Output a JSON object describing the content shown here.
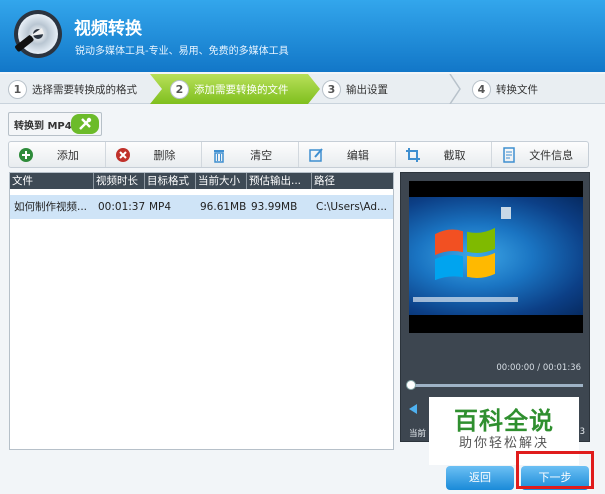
{
  "app": {
    "title": "视频转换",
    "subtitle": "锐动多媒体工具-专业、易用、免费的多媒体工具"
  },
  "steps": [
    {
      "num": "1",
      "label": "选择需要转换成的格式"
    },
    {
      "num": "2",
      "label": "添加需要转换的文件"
    },
    {
      "num": "3",
      "label": "输出设置"
    },
    {
      "num": "4",
      "label": "转换文件"
    }
  ],
  "format_button": {
    "label": "转换到 MP4"
  },
  "toolbar": [
    {
      "label": "添加",
      "icon": "add-icon"
    },
    {
      "label": "删除",
      "icon": "delete-icon"
    },
    {
      "label": "清空",
      "icon": "trash-icon"
    },
    {
      "label": "编辑",
      "icon": "edit-icon"
    },
    {
      "label": "截取",
      "icon": "crop-icon"
    },
    {
      "label": "文件信息",
      "icon": "file-info-icon"
    }
  ],
  "table": {
    "columns": [
      "文件",
      "视频时长",
      "目标格式",
      "当前大小",
      "预估输出...",
      "路径"
    ],
    "rows": [
      [
        "如何制作视频...",
        "00:01:37",
        "MP4",
        "96.61MB",
        "93.99MB",
        "C:\\Users\\Ad..."
      ]
    ]
  },
  "preview": {
    "time": "00:00:00 / 00:01:36",
    "current_label": "当前",
    "end_label": "13"
  },
  "watermark": {
    "title": "百科全说",
    "subtitle": "助你轻松解决"
  },
  "nav": {
    "back": "返回",
    "next": "下一步"
  },
  "colors": {
    "header": "#1a86d4",
    "active_step": "#8cc63f",
    "highlight": "#e01c1c"
  }
}
